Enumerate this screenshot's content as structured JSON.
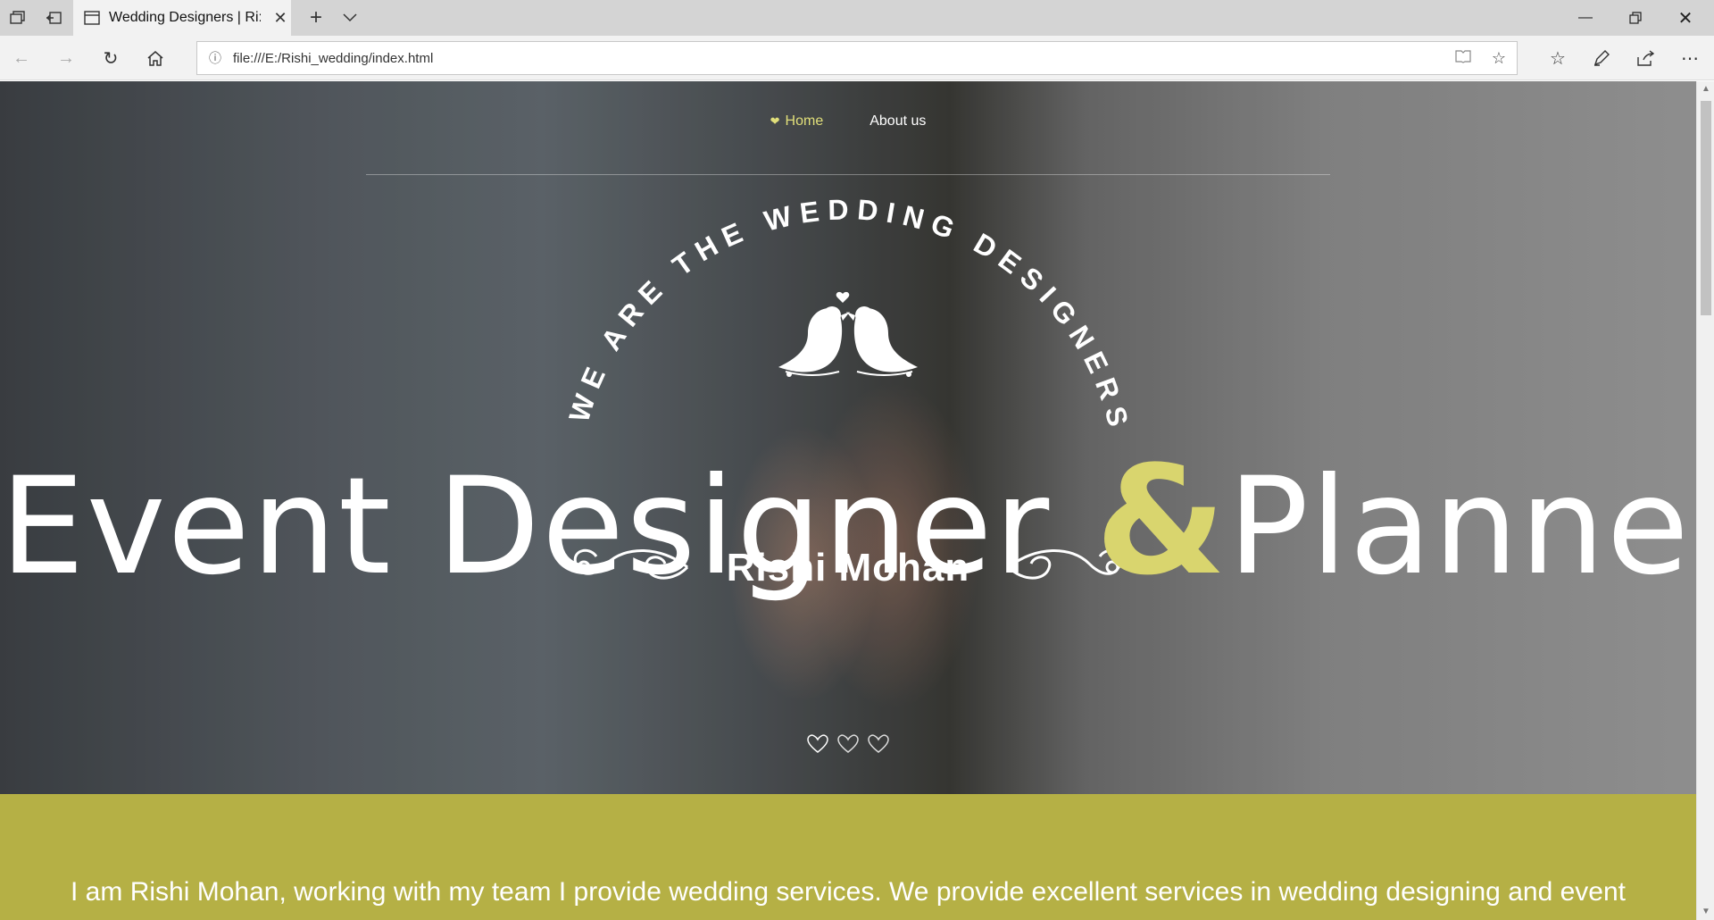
{
  "browser": {
    "tab_title": "Wedding Designers | Ri:",
    "url": "file:///E:/Rishi_wedding/index.html"
  },
  "icons": {
    "tab_manager": "tab-manager-icon",
    "set_aside": "set-aside-tabs-icon",
    "back": "back-arrow-icon",
    "forward": "forward-arrow-icon",
    "refresh": "refresh-icon",
    "home": "home-icon",
    "reading_view": "reading-view-icon",
    "favorite": "star-icon",
    "favorites_hub": "favorites-list-icon",
    "web_note": "pen-icon",
    "share": "share-icon",
    "more": "ellipsis-icon"
  },
  "site": {
    "nav": [
      {
        "label": "Home",
        "active": true
      },
      {
        "label": "About us",
        "active": false
      }
    ],
    "arc_text": "WE ARE THE WEDDING DESIGNERS",
    "headline_part1": "Event Designer ",
    "headline_amp": "&",
    "headline_part2": "Planner",
    "subtitle": "Rishi Mohan",
    "intro_text": "I am Rishi Mohan, working with my team I provide wedding services. We provide excellent services in wedding designing and event",
    "accent_color": "#d9d56e",
    "band_color": "#b5b045"
  }
}
